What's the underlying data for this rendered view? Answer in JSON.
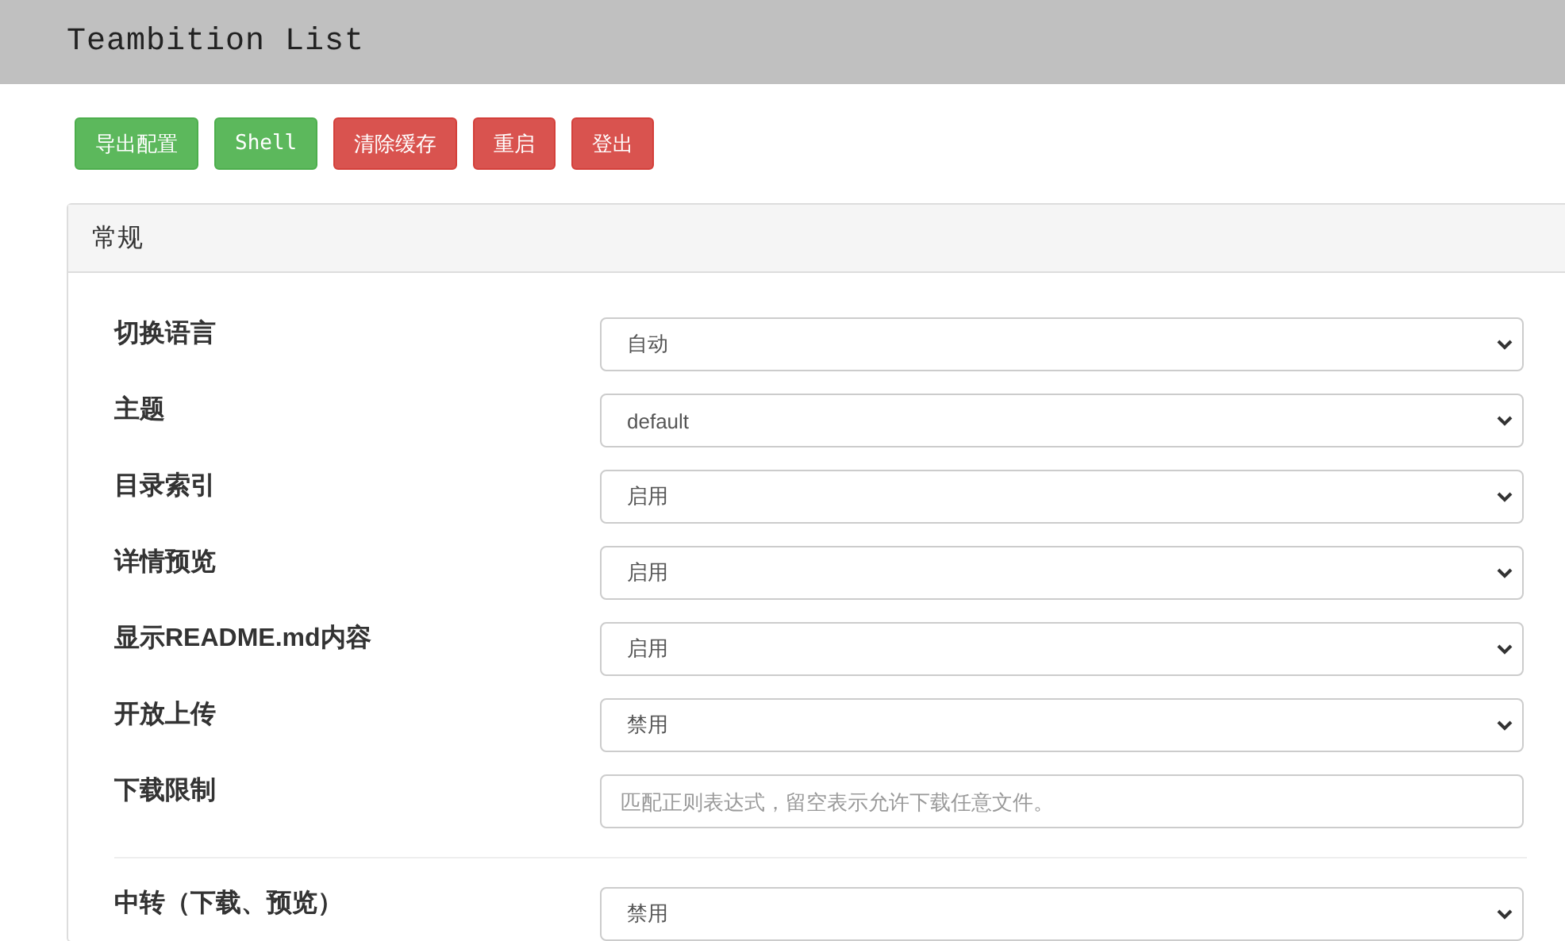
{
  "header": {
    "title": "Teambition List"
  },
  "buttons": [
    {
      "label": "导出配置",
      "kind": "success"
    },
    {
      "label": "Shell",
      "kind": "success"
    },
    {
      "label": "清除缓存",
      "kind": "danger"
    },
    {
      "label": "重启",
      "kind": "danger"
    },
    {
      "label": "登出",
      "kind": "danger"
    }
  ],
  "panel": {
    "title": "常规",
    "groups": [
      {
        "rows": [
          {
            "label": "切换语言",
            "kind": "select",
            "value": "自动"
          },
          {
            "label": "主题",
            "kind": "select",
            "value": "default"
          },
          {
            "label": "目录索引",
            "kind": "select",
            "value": "启用"
          },
          {
            "label": "详情预览",
            "kind": "select",
            "value": "启用"
          },
          {
            "label": "显示README.md内容",
            "kind": "select",
            "value": "启用"
          },
          {
            "label": "开放上传",
            "kind": "select",
            "value": "禁用"
          },
          {
            "label": "下载限制",
            "kind": "text",
            "placeholder": "匹配正则表达式，留空表示允许下载任意文件。"
          }
        ]
      },
      {
        "rows": [
          {
            "label": "中转（下载、预览）",
            "kind": "select",
            "value": "禁用"
          }
        ]
      }
    ]
  }
}
